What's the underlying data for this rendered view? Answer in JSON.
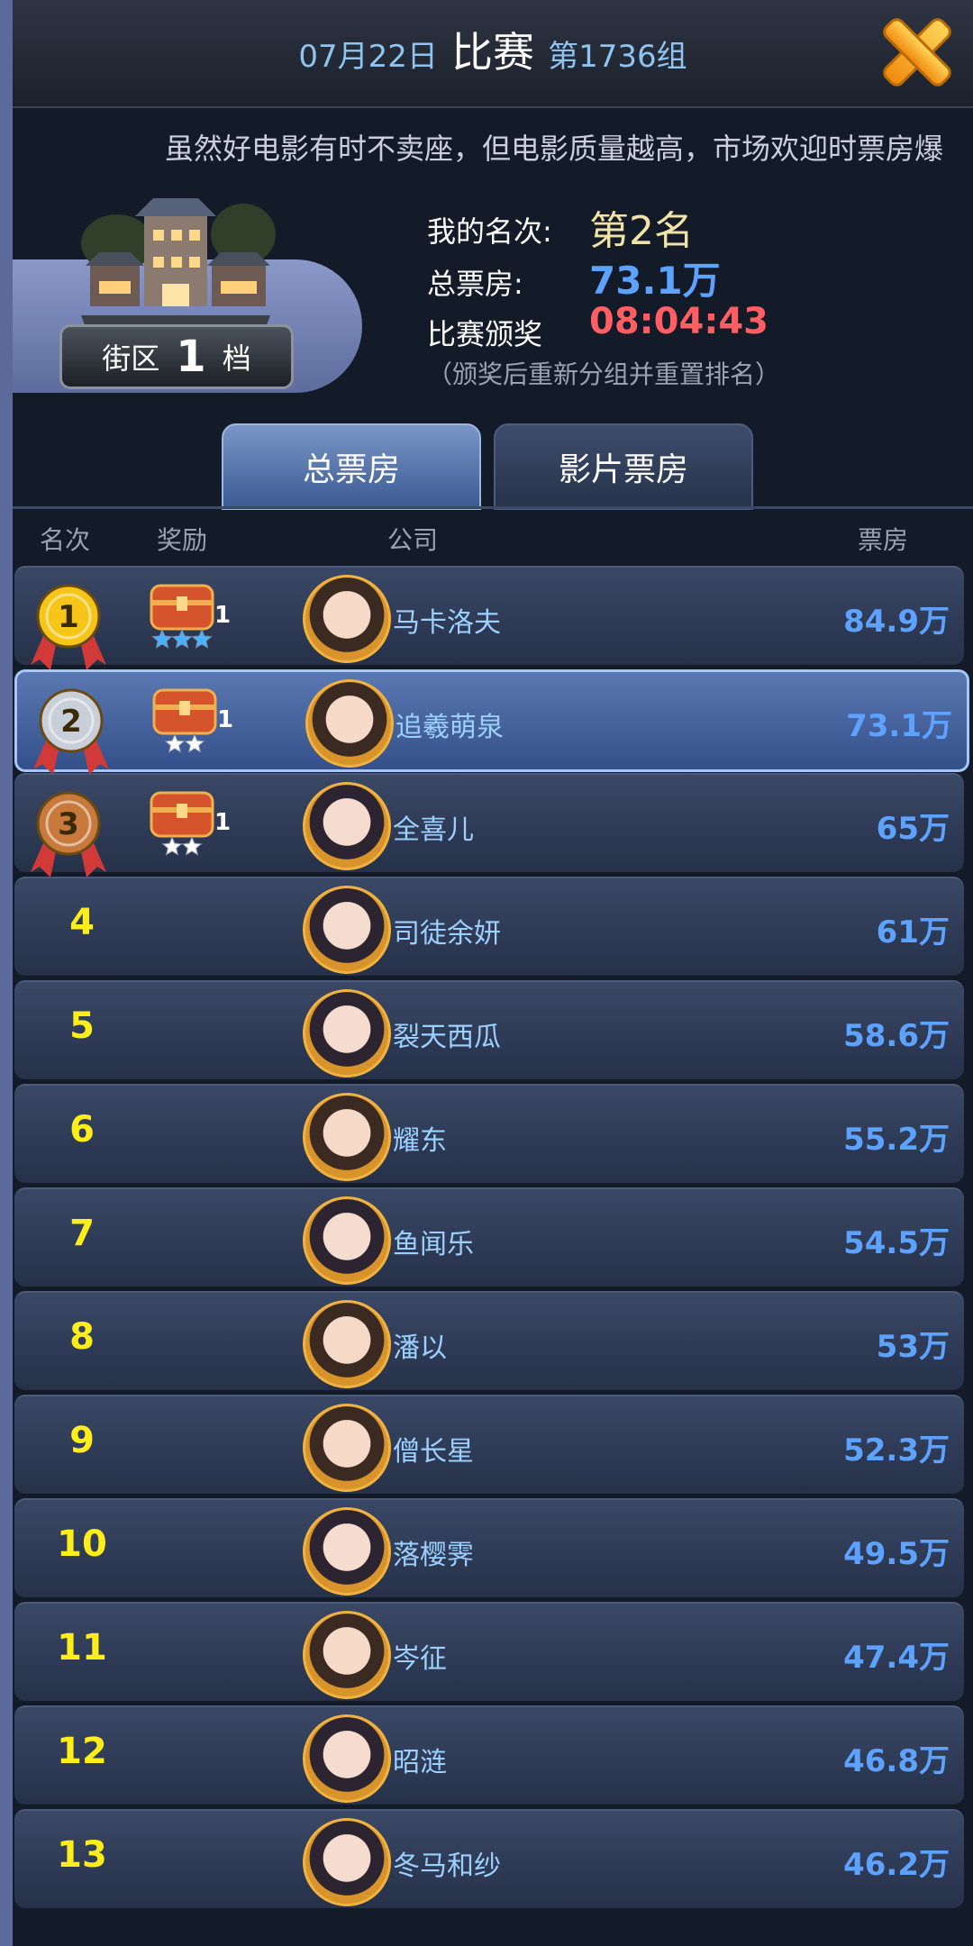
{
  "header": {
    "date": "07月22日",
    "title": "比赛",
    "group": "第1736组"
  },
  "marquee": "虽然好电影有时不卖座，但电影质量越高，市场欢迎时票房爆",
  "district": {
    "prefix": "街区",
    "level": "1",
    "suffix": "档"
  },
  "stats": {
    "rank_label": "我的名次:",
    "rank_value": "第2名",
    "box_label": "总票房:",
    "box_value": "73.1万",
    "award_label": "比赛颁奖",
    "award_timer": "08:04:43",
    "note": "（颁奖后重新分组并重置排名）"
  },
  "tabs": [
    {
      "label": "总票房",
      "active": true
    },
    {
      "label": "影片票房",
      "active": false
    }
  ],
  "columns": {
    "rank": "名次",
    "reward": "奖励",
    "company": "公司",
    "boxoffice": "票房"
  },
  "rows": [
    {
      "rank": "1",
      "reward_count": "1",
      "stars": 3,
      "star_color": "#49b3ff",
      "name": "马卡洛夫",
      "boxoffice": "84.9万",
      "gender": "male"
    },
    {
      "rank": "2",
      "reward_count": "1",
      "stars": 2,
      "star_color": "#ffffff",
      "name": "追羲萌泉",
      "boxoffice": "73.1万",
      "gender": "male"
    },
    {
      "rank": "3",
      "reward_count": "1",
      "stars": 2,
      "star_color": "#ffffff",
      "name": "全喜儿",
      "boxoffice": "65万",
      "gender": "female"
    },
    {
      "rank": "4",
      "name": "司徒余妍",
      "boxoffice": "61万",
      "gender": "female"
    },
    {
      "rank": "5",
      "name": "裂天西瓜",
      "boxoffice": "58.6万",
      "gender": "female"
    },
    {
      "rank": "6",
      "name": "耀东",
      "boxoffice": "55.2万",
      "gender": "male"
    },
    {
      "rank": "7",
      "name": "鱼闻乐",
      "boxoffice": "54.5万",
      "gender": "female"
    },
    {
      "rank": "8",
      "name": "潘以",
      "boxoffice": "53万",
      "gender": "male"
    },
    {
      "rank": "9",
      "name": "僧长星",
      "boxoffice": "52.3万",
      "gender": "male"
    },
    {
      "rank": "10",
      "name": "落樱霁",
      "boxoffice": "49.5万",
      "gender": "female"
    },
    {
      "rank": "11",
      "name": "岑征",
      "boxoffice": "47.4万",
      "gender": "male"
    },
    {
      "rank": "12",
      "name": "昭涟",
      "boxoffice": "46.8万",
      "gender": "female"
    },
    {
      "rank": "13",
      "name": "冬马和纱",
      "boxoffice": "46.2万",
      "gender": "female"
    }
  ],
  "colors": {
    "gold": "#f5c518",
    "silver": "#c9cfd8",
    "bronze": "#c77a3c",
    "rank_text": "#ffee1a",
    "boxoffice_text": "#5ea2ff",
    "timer_text": "#ff5e62"
  },
  "icons": [
    "close-icon",
    "building-icon",
    "medal-icon",
    "treasure-chest-icon",
    "star-icon",
    "avatar-icon"
  ]
}
